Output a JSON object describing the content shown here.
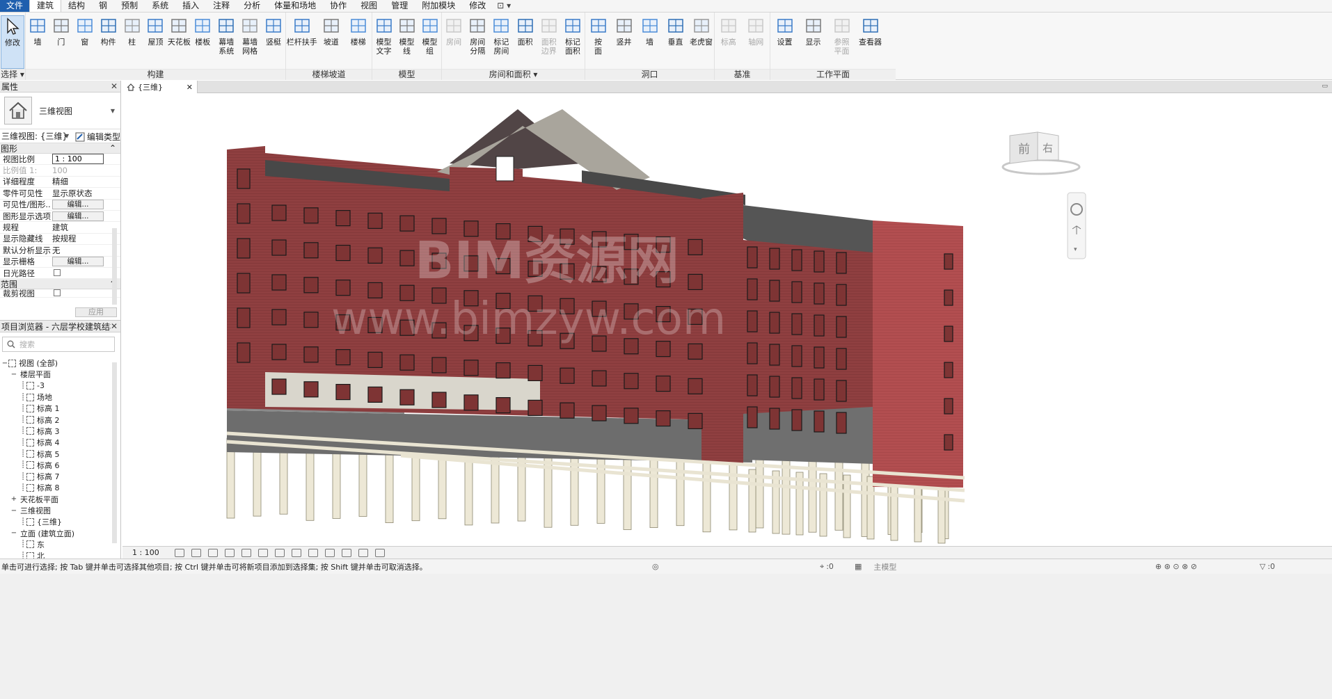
{
  "menu": {
    "tabs": [
      "文件",
      "建筑",
      "结构",
      "钢",
      "预制",
      "系统",
      "插入",
      "注释",
      "分析",
      "体量和场地",
      "协作",
      "视图",
      "管理",
      "附加模块",
      "修改"
    ],
    "extra_icon": "quick-access-menu-icon"
  },
  "ribbon": {
    "select": {
      "tool": "修改",
      "label": "选择"
    },
    "build": {
      "label": "构建",
      "tools": [
        "墙",
        "门",
        "窗",
        "构件",
        "柱",
        "屋顶",
        "天花板",
        "楼板",
        "幕墙\n系统",
        "幕墙\n网格",
        "竖梃"
      ]
    },
    "stairs": {
      "label": "楼梯坡道",
      "tools": [
        "栏杆扶手",
        "坡道",
        "楼梯"
      ]
    },
    "model": {
      "label": "模型",
      "tools": [
        "模型\n文字",
        "模型\n线",
        "模型\n组"
      ]
    },
    "room": {
      "label": "房间和面积",
      "tools": [
        "房间",
        "房间\n分隔",
        "标记\n房间",
        "面积",
        "面积\n边界",
        "标记\n面积"
      ]
    },
    "opening": {
      "label": "洞口",
      "tools": [
        "按\n面",
        "竖井",
        "墙",
        "垂直",
        "老虎窗"
      ]
    },
    "datum": {
      "label": "基准",
      "tools": [
        "标高",
        "轴网"
      ]
    },
    "workplane": {
      "label": "工作平面",
      "tools": [
        "设置",
        "显示",
        "参照\n平面",
        "查看器"
      ]
    }
  },
  "properties": {
    "title": "属性",
    "type_name": "三维视图",
    "view_selector": "三维视图: {三维}",
    "edit_type": "编辑类型",
    "group_graphics": "图形",
    "rows": [
      {
        "k": "视图比例",
        "v": "1 : 100",
        "kind": "input"
      },
      {
        "k": "比例值 1:",
        "v": "100",
        "kind": "dis"
      },
      {
        "k": "详细程度",
        "v": "精细",
        "kind": "text"
      },
      {
        "k": "零件可见性",
        "v": "显示原状态",
        "kind": "text"
      },
      {
        "k": "可见性/图形...",
        "v": "编辑...",
        "kind": "button"
      },
      {
        "k": "图形显示选项",
        "v": "编辑...",
        "kind": "button"
      },
      {
        "k": "规程",
        "v": "建筑",
        "kind": "text"
      },
      {
        "k": "显示隐藏线",
        "v": "按规程",
        "kind": "text"
      },
      {
        "k": "默认分析显示...",
        "v": "无",
        "kind": "text"
      },
      {
        "k": "显示栅格",
        "v": "编辑...",
        "kind": "button"
      },
      {
        "k": "日光路径",
        "v": "",
        "kind": "check"
      }
    ],
    "group_extents": "范围",
    "crop_row": "裁剪视图",
    "apply": "应用"
  },
  "browser": {
    "title": "项目浏览器 - 六层学校建筑结构.rvt",
    "search_placeholder": "搜索",
    "tree": [
      {
        "t": "视图 (全部)",
        "lvl": 0,
        "tog": "−",
        "ic": true
      },
      {
        "t": "楼层平面",
        "lvl": 1,
        "tog": "−",
        "ic": false
      },
      {
        "t": "-3",
        "lvl": 2,
        "tog": "",
        "ic": true
      },
      {
        "t": "场地",
        "lvl": 2,
        "tog": "",
        "ic": true
      },
      {
        "t": "标高 1",
        "lvl": 2,
        "tog": "",
        "ic": true
      },
      {
        "t": "标高 2",
        "lvl": 2,
        "tog": "",
        "ic": true
      },
      {
        "t": "标高 3",
        "lvl": 2,
        "tog": "",
        "ic": true
      },
      {
        "t": "标高 4",
        "lvl": 2,
        "tog": "",
        "ic": true
      },
      {
        "t": "标高 5",
        "lvl": 2,
        "tog": "",
        "ic": true
      },
      {
        "t": "标高 6",
        "lvl": 2,
        "tog": "",
        "ic": true
      },
      {
        "t": "标高 7",
        "lvl": 2,
        "tog": "",
        "ic": true
      },
      {
        "t": "标高 8",
        "lvl": 2,
        "tog": "",
        "ic": true
      },
      {
        "t": "天花板平面",
        "lvl": 1,
        "tog": "+",
        "ic": false
      },
      {
        "t": "三维视图",
        "lvl": 1,
        "tog": "−",
        "ic": false
      },
      {
        "t": "{三维}",
        "lvl": 2,
        "tog": "",
        "ic": true
      },
      {
        "t": "立面 (建筑立面)",
        "lvl": 1,
        "tog": "−",
        "ic": false
      },
      {
        "t": "东",
        "lvl": 2,
        "tog": "",
        "ic": true
      },
      {
        "t": "北",
        "lvl": 2,
        "tog": "",
        "ic": true
      }
    ]
  },
  "view": {
    "tab_label": "{三维}",
    "watermark_cn": "BIM资源网",
    "watermark_url": "www.bimzyw.com",
    "viewcube_front": "前",
    "viewcube_right": "右",
    "scale": "1 : 100"
  },
  "status": {
    "message": "单击可进行选择; 按 Tab 键并单击可选择其他项目; 按 Ctrl 键并单击可将新项目添加到选择集; 按 Shift 键并单击可取消选择。",
    "zero_a": ":0",
    "model": "主模型",
    "filter": ":0"
  },
  "colors": {
    "accent": "#1f5fae",
    "brick": "#8e3f3f",
    "roof": "#a9a59c",
    "column": "#ede8d6"
  }
}
